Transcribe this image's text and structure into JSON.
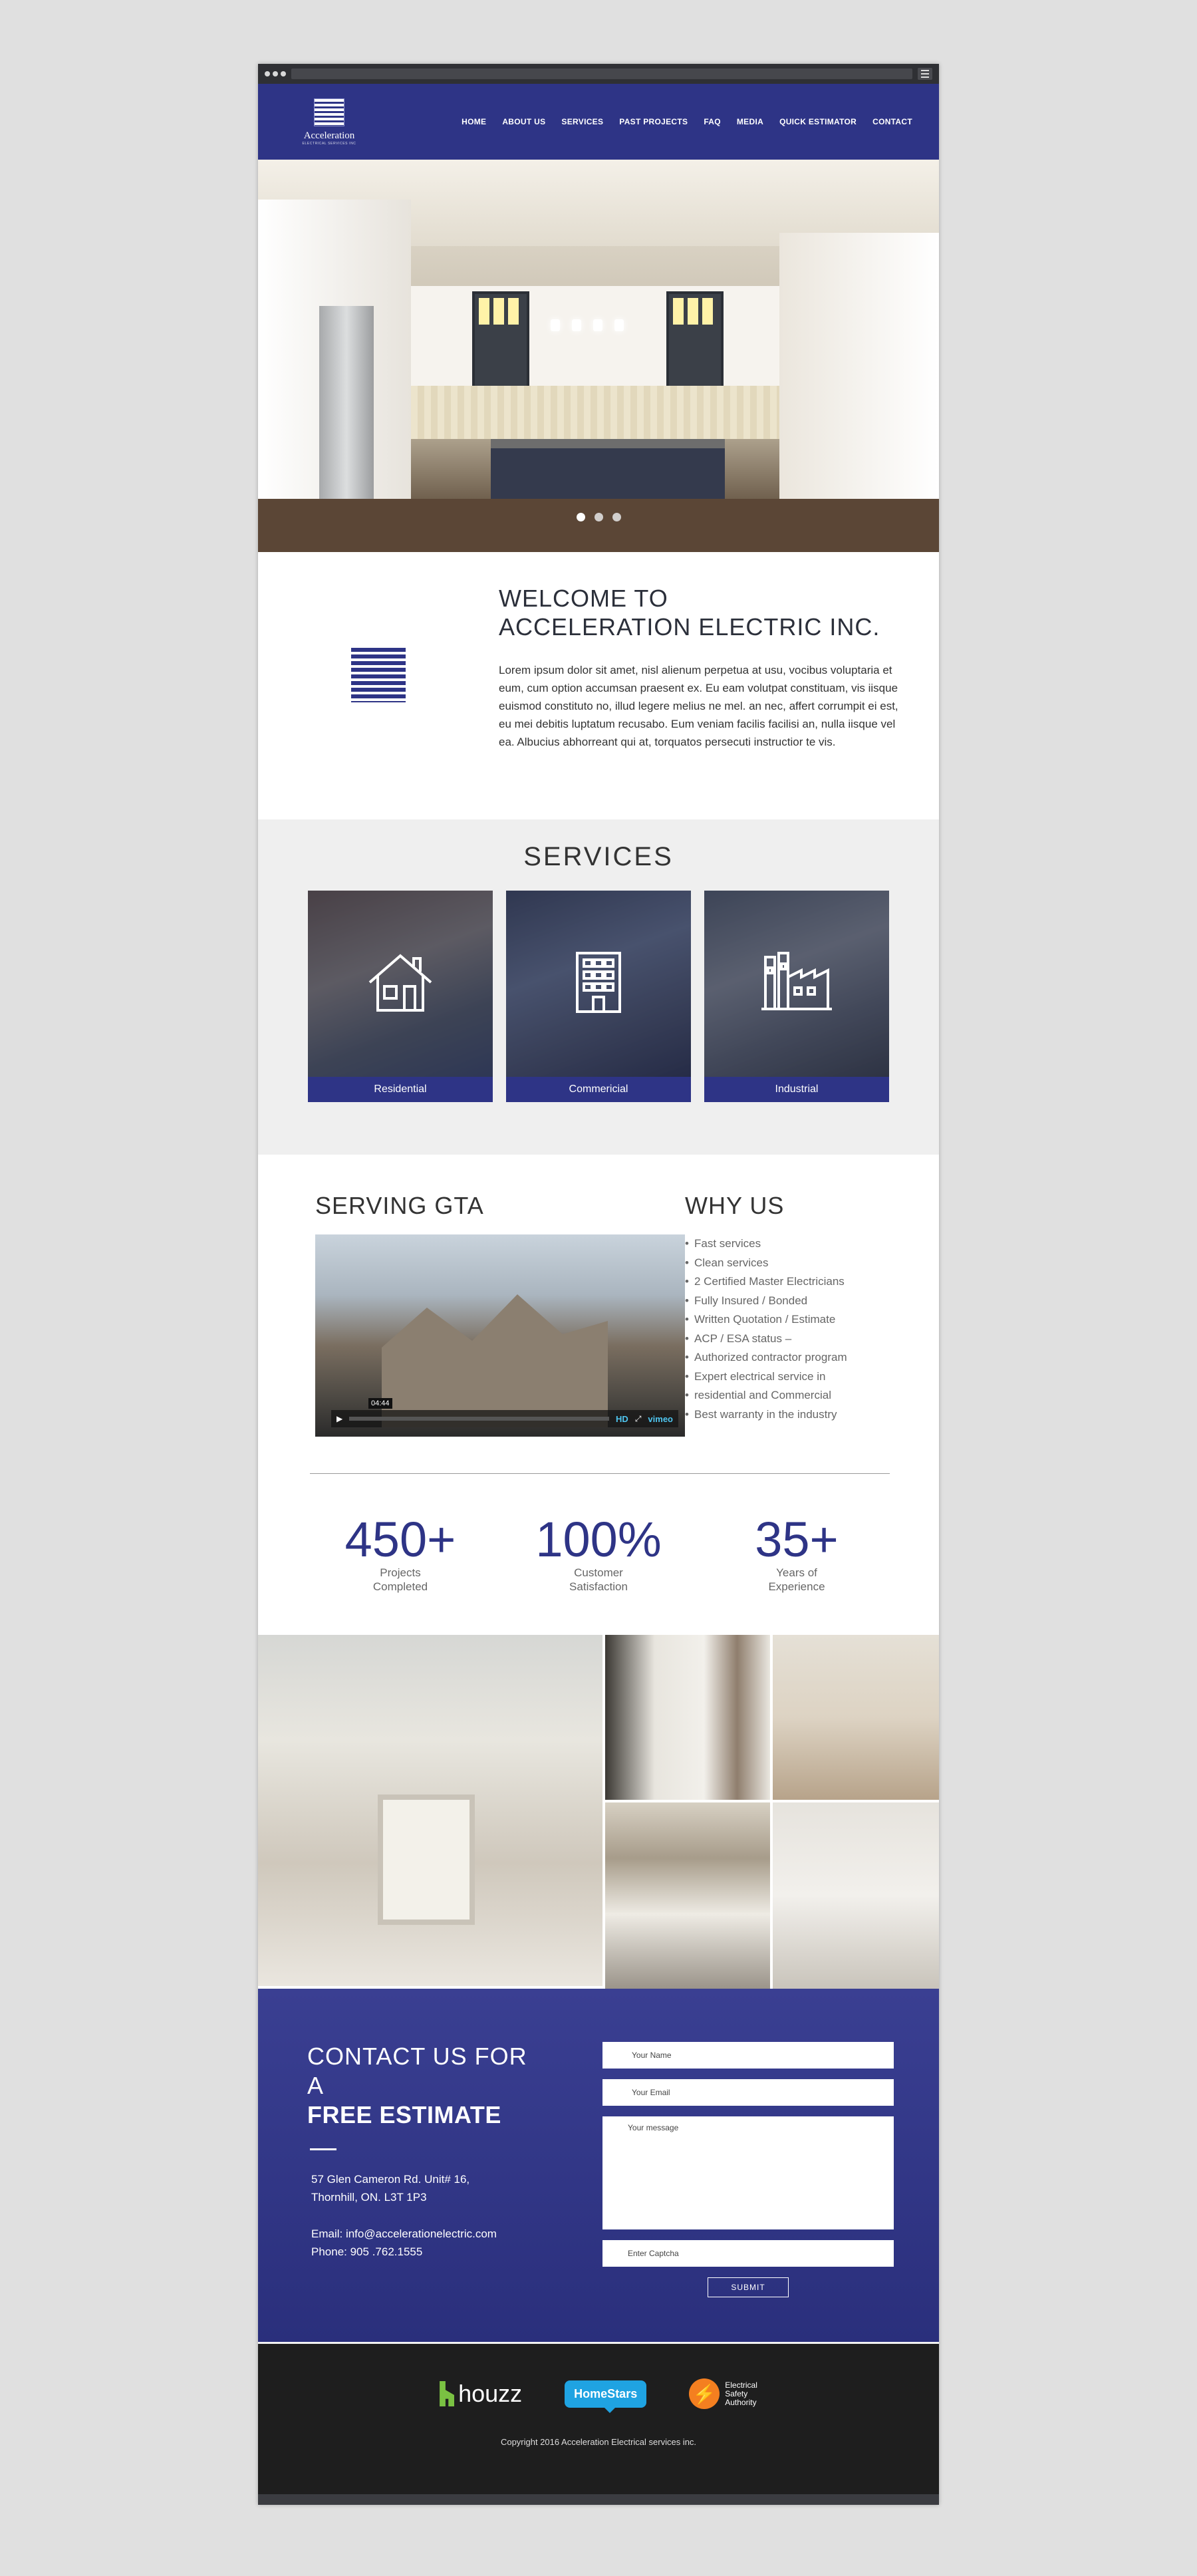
{
  "nav": {
    "logo_name": "Acceleration",
    "logo_sub": "ELECTRICAL SERVICES INC",
    "items": [
      "HOME",
      "ABOUT US",
      "SERVICES",
      "PAST PROJECTS",
      "FAQ",
      "MEDIA",
      "QUICK ESTIMATOR",
      "CONTACT"
    ]
  },
  "hero": {
    "slides": 3,
    "active_slide": 1
  },
  "welcome": {
    "line1": "WELCOME TO",
    "line2": "ACCELERATION ELECTRIC INC.",
    "body": "Lorem ipsum dolor sit amet, nisl alienum perpetua at usu, vocibus voluptaria et eum, cum option accumsan praesent ex. Eu eam volutpat constituam, vis iisque euismod constituto no, illud legere melius ne mel. an nec, affert corrumpit ei est, eu mei debitis luptatum recusabo. Eum veniam facilis facilisi an, nulla iisque vel ea. Albucius abhorreant qui at, torquatos persecuti instructior te vis."
  },
  "services": {
    "title": "SERVICES",
    "cards": [
      {
        "label": "Residential",
        "icon": "house-icon"
      },
      {
        "label": "Commericial",
        "icon": "office-building-icon"
      },
      {
        "label": "Industrial",
        "icon": "factory-icon"
      }
    ]
  },
  "serving": {
    "title": "SERVING GTA",
    "video_time": "04:44",
    "video_brand": "vimeo",
    "video_hd": "HD"
  },
  "why": {
    "title": "WHY US",
    "items": [
      "Fast services",
      "Clean services",
      "2 Certified Master Electricians",
      "Fully Insured / Bonded",
      "Written Quotation / Estimate",
      "ACP / ESA status –",
      "Authorized contractor program",
      "Expert electrical service in",
      "residential and Commercial",
      "Best warranty in the industry"
    ]
  },
  "stats": [
    {
      "value": "450+",
      "line1": "Projects",
      "line2": "Completed"
    },
    {
      "value": "100%",
      "line1": "Customer",
      "line2": "Satisfaction"
    },
    {
      "value": "35+",
      "line1": "Years of",
      "line2": "Experience"
    }
  ],
  "contact": {
    "title1": "CONTACT US FOR A",
    "title2": "FREE ESTIMATE",
    "address1": "57 Glen Cameron Rd. Unit# 16,",
    "address2": "Thornhill, ON. L3T 1P3",
    "email": "Email: info@accelerationelectric.com",
    "phone": "Phone: 905 .762.1555",
    "form": {
      "name_placeholder": "Your Name",
      "email_placeholder": "Your Email",
      "message_placeholder": "Your message",
      "captcha_placeholder": "Enter Captcha",
      "submit_label": "SUBMIT"
    }
  },
  "footer": {
    "partners": {
      "houzz": "houzz",
      "homestars": "HomeStars",
      "esa1": "Electrical",
      "esa2": "Safety",
      "esa3": "Authority"
    },
    "copyright": "Copyright 2016 Acceleration Electrical services inc."
  },
  "colors": {
    "brand": "#2e3486",
    "footer": "#1e1e1e",
    "services_bg": "#efefef"
  }
}
